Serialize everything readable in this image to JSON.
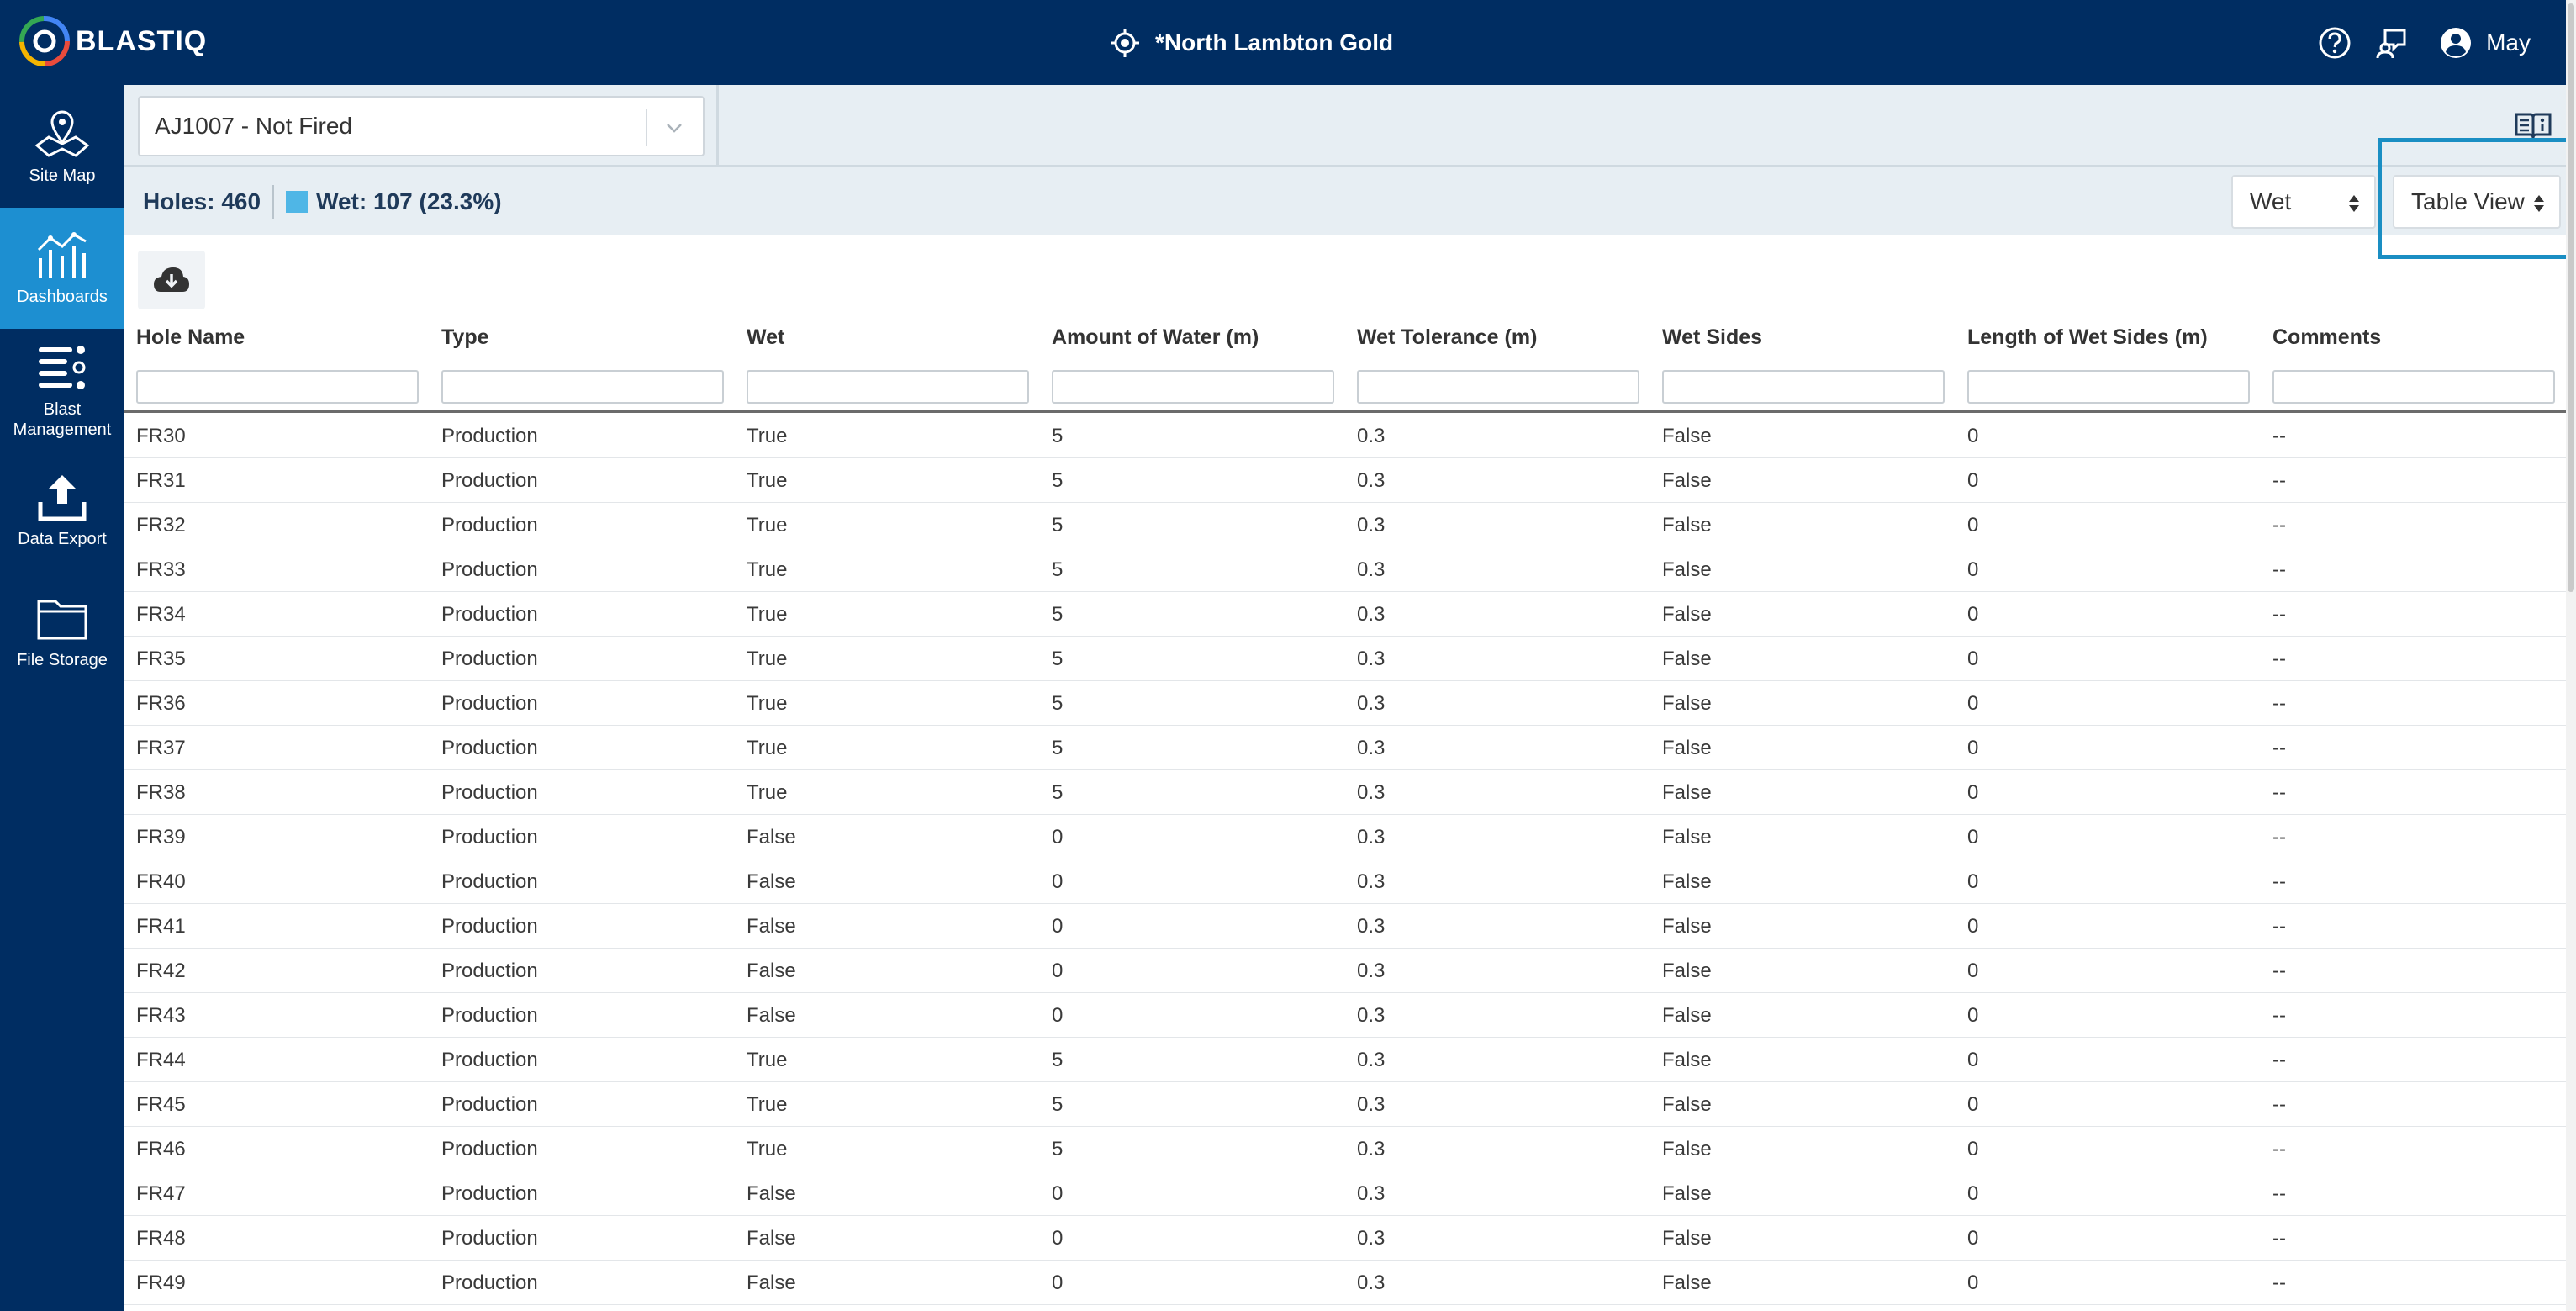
{
  "app": {
    "logo_text": "BLASTIQ"
  },
  "header": {
    "site_name": "*North Lambton Gold",
    "user_name": "May"
  },
  "sidebar": {
    "items": [
      {
        "label": "Site Map",
        "icon": "map-pin-icon",
        "active": false
      },
      {
        "label": "Dashboards",
        "icon": "dashboard-chart-icon",
        "active": true
      },
      {
        "label": "Blast Management",
        "icon": "list-management-icon",
        "active": false
      },
      {
        "label": "Data Export",
        "icon": "upload-icon",
        "active": false
      },
      {
        "label": "File Storage",
        "icon": "folder-icon",
        "active": false
      }
    ]
  },
  "toolbar": {
    "blast_select_value": "AJ1007 - Not Fired",
    "holes_label": "Holes: 460",
    "wet_label": "Wet: 107 (23.3%)",
    "wet_color": "#4fb6e6",
    "attribute_select_value": "Wet",
    "view_select_value": "Table View",
    "highlight_color": "#1a8ec3"
  },
  "table": {
    "columns": [
      "Hole Name",
      "Type",
      "Wet",
      "Amount of Water (m)",
      "Wet Tolerance (m)",
      "Wet Sides",
      "Length of Wet Sides (m)",
      "Comments"
    ],
    "rows": [
      [
        "FR30",
        "Production",
        "True",
        "5",
        "0.3",
        "False",
        "0",
        "--"
      ],
      [
        "FR31",
        "Production",
        "True",
        "5",
        "0.3",
        "False",
        "0",
        "--"
      ],
      [
        "FR32",
        "Production",
        "True",
        "5",
        "0.3",
        "False",
        "0",
        "--"
      ],
      [
        "FR33",
        "Production",
        "True",
        "5",
        "0.3",
        "False",
        "0",
        "--"
      ],
      [
        "FR34",
        "Production",
        "True",
        "5",
        "0.3",
        "False",
        "0",
        "--"
      ],
      [
        "FR35",
        "Production",
        "True",
        "5",
        "0.3",
        "False",
        "0",
        "--"
      ],
      [
        "FR36",
        "Production",
        "True",
        "5",
        "0.3",
        "False",
        "0",
        "--"
      ],
      [
        "FR37",
        "Production",
        "True",
        "5",
        "0.3",
        "False",
        "0",
        "--"
      ],
      [
        "FR38",
        "Production",
        "True",
        "5",
        "0.3",
        "False",
        "0",
        "--"
      ],
      [
        "FR39",
        "Production",
        "False",
        "0",
        "0.3",
        "False",
        "0",
        "--"
      ],
      [
        "FR40",
        "Production",
        "False",
        "0",
        "0.3",
        "False",
        "0",
        "--"
      ],
      [
        "FR41",
        "Production",
        "False",
        "0",
        "0.3",
        "False",
        "0",
        "--"
      ],
      [
        "FR42",
        "Production",
        "False",
        "0",
        "0.3",
        "False",
        "0",
        "--"
      ],
      [
        "FR43",
        "Production",
        "False",
        "0",
        "0.3",
        "False",
        "0",
        "--"
      ],
      [
        "FR44",
        "Production",
        "True",
        "5",
        "0.3",
        "False",
        "0",
        "--"
      ],
      [
        "FR45",
        "Production",
        "True",
        "5",
        "0.3",
        "False",
        "0",
        "--"
      ],
      [
        "FR46",
        "Production",
        "True",
        "5",
        "0.3",
        "False",
        "0",
        "--"
      ],
      [
        "FR47",
        "Production",
        "False",
        "0",
        "0.3",
        "False",
        "0",
        "--"
      ],
      [
        "FR48",
        "Production",
        "False",
        "0",
        "0.3",
        "False",
        "0",
        "--"
      ],
      [
        "FR49",
        "Production",
        "False",
        "0",
        "0.3",
        "False",
        "0",
        "--"
      ]
    ]
  }
}
